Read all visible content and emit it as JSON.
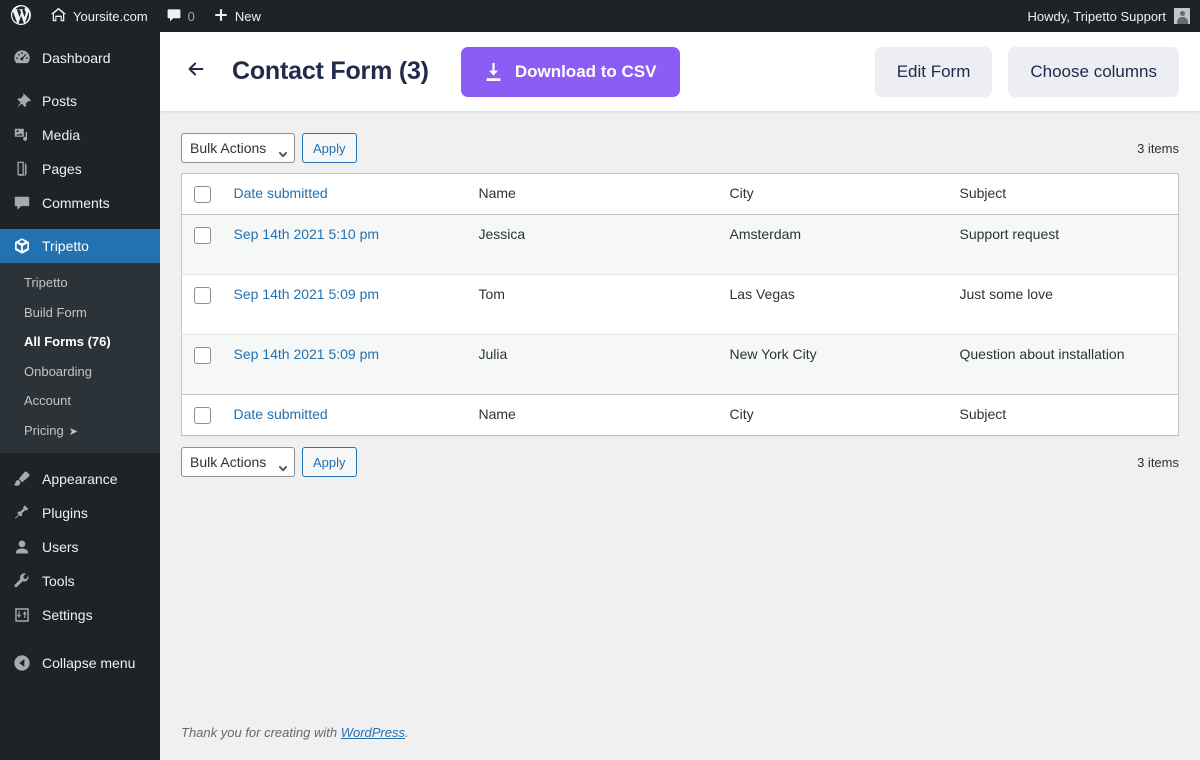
{
  "adminbar": {
    "wp_logo": "wordpress-logo-icon",
    "site_name": "Yoursite.com",
    "comments_count": "0",
    "new_label": "New",
    "howdy": "Howdy, Tripetto Support"
  },
  "sidebar": {
    "items": [
      {
        "label": "Dashboard",
        "icon": "dashboard-icon"
      },
      {
        "label": "Posts",
        "icon": "pin-icon"
      },
      {
        "label": "Media",
        "icon": "media-icon"
      },
      {
        "label": "Pages",
        "icon": "pages-icon"
      },
      {
        "label": "Comments",
        "icon": "comment-icon"
      },
      {
        "label": "Tripetto",
        "icon": "tripetto-icon",
        "active": true
      }
    ],
    "submenu": [
      {
        "label": "Tripetto"
      },
      {
        "label": "Build Form"
      },
      {
        "label": "All Forms (76)",
        "current": true
      },
      {
        "label": "Onboarding"
      },
      {
        "label": "Account"
      },
      {
        "label": "Pricing",
        "external": "➤"
      }
    ],
    "items_lower": [
      {
        "label": "Appearance",
        "icon": "brush-icon"
      },
      {
        "label": "Plugins",
        "icon": "plug-icon"
      },
      {
        "label": "Users",
        "icon": "user-icon"
      },
      {
        "label": "Tools",
        "icon": "wrench-icon"
      },
      {
        "label": "Settings",
        "icon": "settings-icon"
      }
    ],
    "collapse": {
      "label": "Collapse menu",
      "icon": "collapse-arrow-icon"
    }
  },
  "header": {
    "back_icon": "arrow-left-icon",
    "title": "Contact Form (3)",
    "download_label": "Download to CSV",
    "download_icon": "download-icon",
    "edit_form_label": "Edit Form",
    "choose_columns_label": "Choose columns",
    "accent_purple": "#8b5cf6",
    "title_navy": "#25294a"
  },
  "tablenav_top": {
    "bulk_actions_label": "Bulk Actions",
    "apply_label": "Apply",
    "items_count": "3 items"
  },
  "tablenav_bottom": {
    "bulk_actions_label": "Bulk Actions",
    "apply_label": "Apply",
    "items_count": "3 items"
  },
  "table": {
    "columns": [
      "Date submitted",
      "Name",
      "City",
      "Subject"
    ],
    "rows": [
      {
        "date": "Sep 14th 2021 5:10 pm",
        "name": "Jessica",
        "city": "Amsterdam",
        "subject": "Support request"
      },
      {
        "date": "Sep 14th 2021 5:09 pm",
        "name": "Tom",
        "city": "Las Vegas",
        "subject": "Just some love"
      },
      {
        "date": "Sep 14th 2021 5:09 pm",
        "name": "Julia",
        "city": "New York City",
        "subject": "Question about installation"
      }
    ]
  },
  "footer": {
    "text_before": "Thank you for creating with ",
    "link": "WordPress",
    "text_after": "."
  }
}
